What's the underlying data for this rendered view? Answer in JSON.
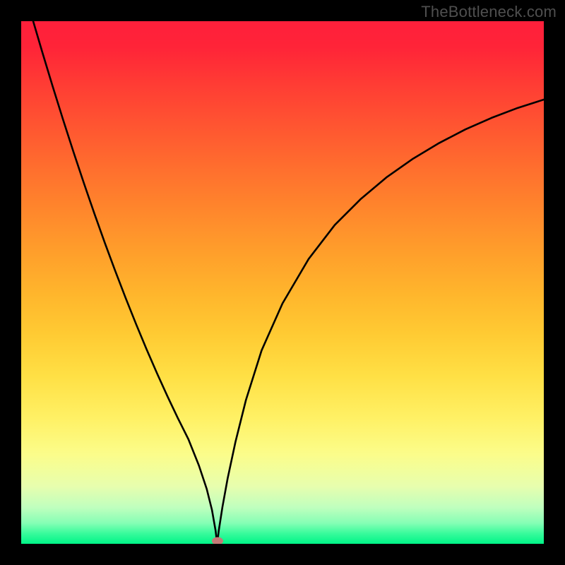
{
  "watermark": "TheBottleneck.com",
  "chart_data": {
    "type": "line",
    "title": "",
    "xlabel": "",
    "ylabel": "",
    "xlim": [
      0,
      1
    ],
    "ylim": [
      0,
      1
    ],
    "notch_x": 0.375,
    "marker": {
      "x": 0.375,
      "y": 0.005
    },
    "series": [
      {
        "name": "curve",
        "x": [
          0.0,
          0.02,
          0.04,
          0.06,
          0.08,
          0.1,
          0.12,
          0.14,
          0.16,
          0.18,
          0.2,
          0.22,
          0.24,
          0.26,
          0.28,
          0.3,
          0.32,
          0.34,
          0.355,
          0.365,
          0.372,
          0.375,
          0.378,
          0.385,
          0.395,
          0.41,
          0.43,
          0.46,
          0.5,
          0.55,
          0.6,
          0.65,
          0.7,
          0.75,
          0.8,
          0.85,
          0.9,
          0.95,
          1.0
        ],
        "y": [
          1.08,
          1.01,
          0.942,
          0.876,
          0.812,
          0.75,
          0.69,
          0.632,
          0.576,
          0.522,
          0.47,
          0.42,
          0.372,
          0.326,
          0.282,
          0.24,
          0.2,
          0.15,
          0.105,
          0.065,
          0.025,
          0.0,
          0.025,
          0.07,
          0.125,
          0.195,
          0.275,
          0.37,
          0.46,
          0.545,
          0.61,
          0.66,
          0.702,
          0.737,
          0.767,
          0.793,
          0.815,
          0.834,
          0.85
        ]
      }
    ],
    "background_gradient": {
      "top": "#ff1f3b",
      "mid": "#ffe045",
      "bottom": "#00f487"
    }
  }
}
